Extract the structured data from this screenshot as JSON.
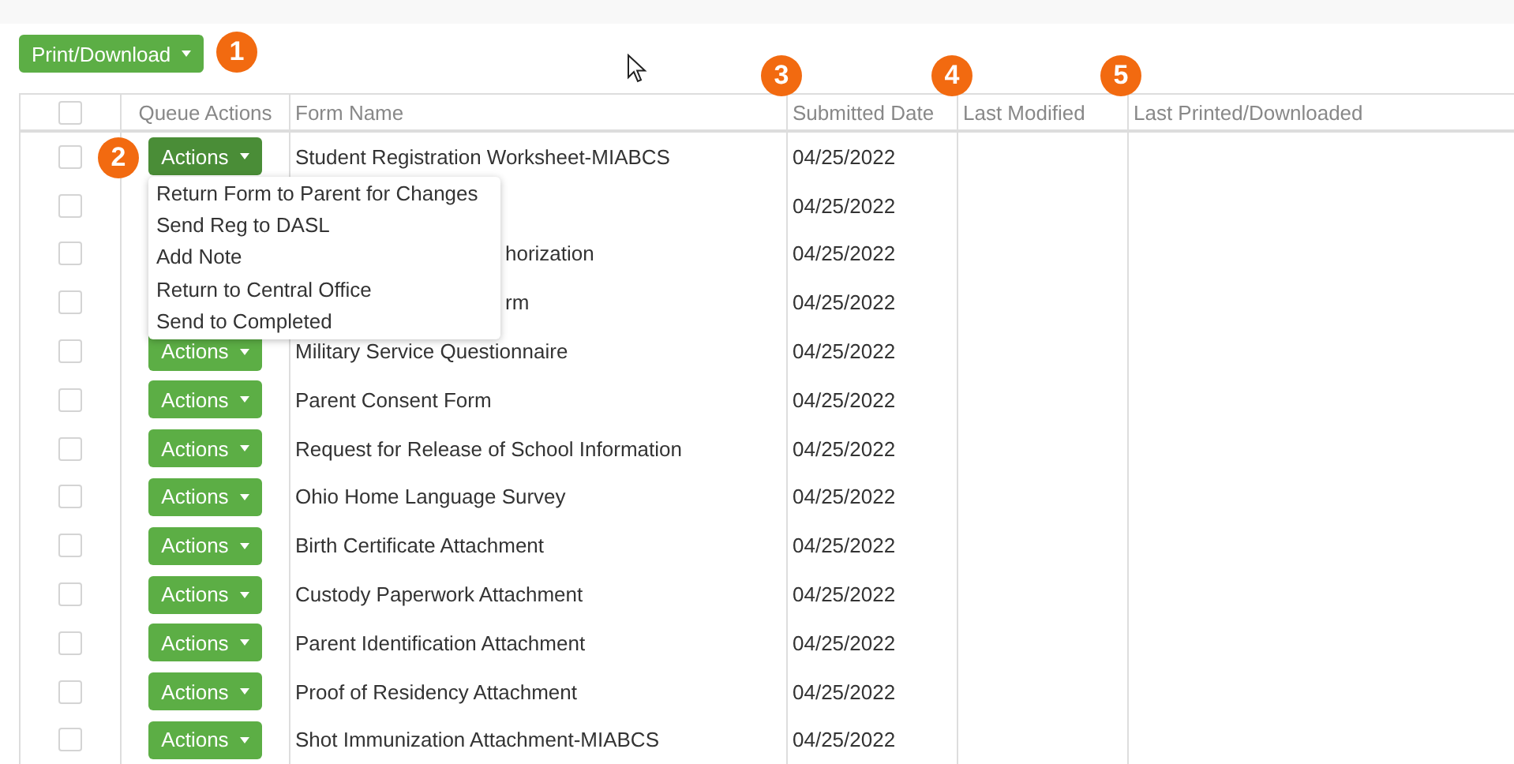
{
  "toolbar": {
    "print_button": "Print/Download"
  },
  "callouts": [
    "1",
    "2",
    "3",
    "4",
    "5"
  ],
  "table": {
    "columns": [
      "Queue Actions",
      "Form Name",
      "Submitted Date",
      "Last Modified",
      "Last Printed/Downloaded"
    ],
    "header_checkbox": {
      "checked": false
    },
    "rows": [
      {
        "checked": false,
        "actions": {
          "label": "Actions",
          "open": true
        },
        "form_name": "Student Registration Worksheet-MIABCS",
        "submitted": "04/25/2022"
      },
      {
        "checked": false,
        "submitted": "04/25/2022"
      },
      {
        "checked": false,
        "form_name": "horization",
        "name_partly_hidden": true,
        "submitted": "04/25/2022"
      },
      {
        "checked": false,
        "form_name": "rm",
        "name_partly_hidden": true,
        "submitted": "04/25/2022"
      },
      {
        "checked": false,
        "actions": {
          "label": "Actions",
          "open": false
        },
        "form_name": "Military Service Questionnaire",
        "submitted": "04/25/2022"
      },
      {
        "checked": false,
        "actions": {
          "label": "Actions",
          "open": false
        },
        "form_name": "Parent Consent Form",
        "submitted": "04/25/2022"
      },
      {
        "checked": false,
        "actions": {
          "label": "Actions",
          "open": false
        },
        "form_name": "Request for Release of School Information",
        "submitted": "04/25/2022"
      },
      {
        "checked": false,
        "actions": {
          "label": "Actions",
          "open": false
        },
        "form_name": "Ohio Home Language Survey",
        "submitted": "04/25/2022"
      },
      {
        "checked": false,
        "actions": {
          "label": "Actions",
          "open": false
        },
        "form_name": "Birth Certificate Attachment",
        "submitted": "04/25/2022"
      },
      {
        "checked": false,
        "actions": {
          "label": "Actions",
          "open": false
        },
        "form_name": "Custody Paperwork Attachment",
        "submitted": "04/25/2022"
      },
      {
        "checked": false,
        "actions": {
          "label": "Actions",
          "open": false
        },
        "form_name": "Parent Identification Attachment",
        "submitted": "04/25/2022"
      },
      {
        "checked": false,
        "actions": {
          "label": "Actions",
          "open": false
        },
        "form_name": "Proof of Residency Attachment",
        "submitted": "04/25/2022"
      },
      {
        "checked": false,
        "actions": {
          "label": "Actions",
          "open": false
        },
        "form_name": "Shot Immunization Attachment-MIABCS",
        "submitted": "04/25/2022"
      }
    ]
  },
  "actions_menu": [
    "Return Form to Parent for Changes",
    "Send Reg to DASL",
    "Add Note",
    "Return to Central Office",
    "Send to Completed"
  ]
}
